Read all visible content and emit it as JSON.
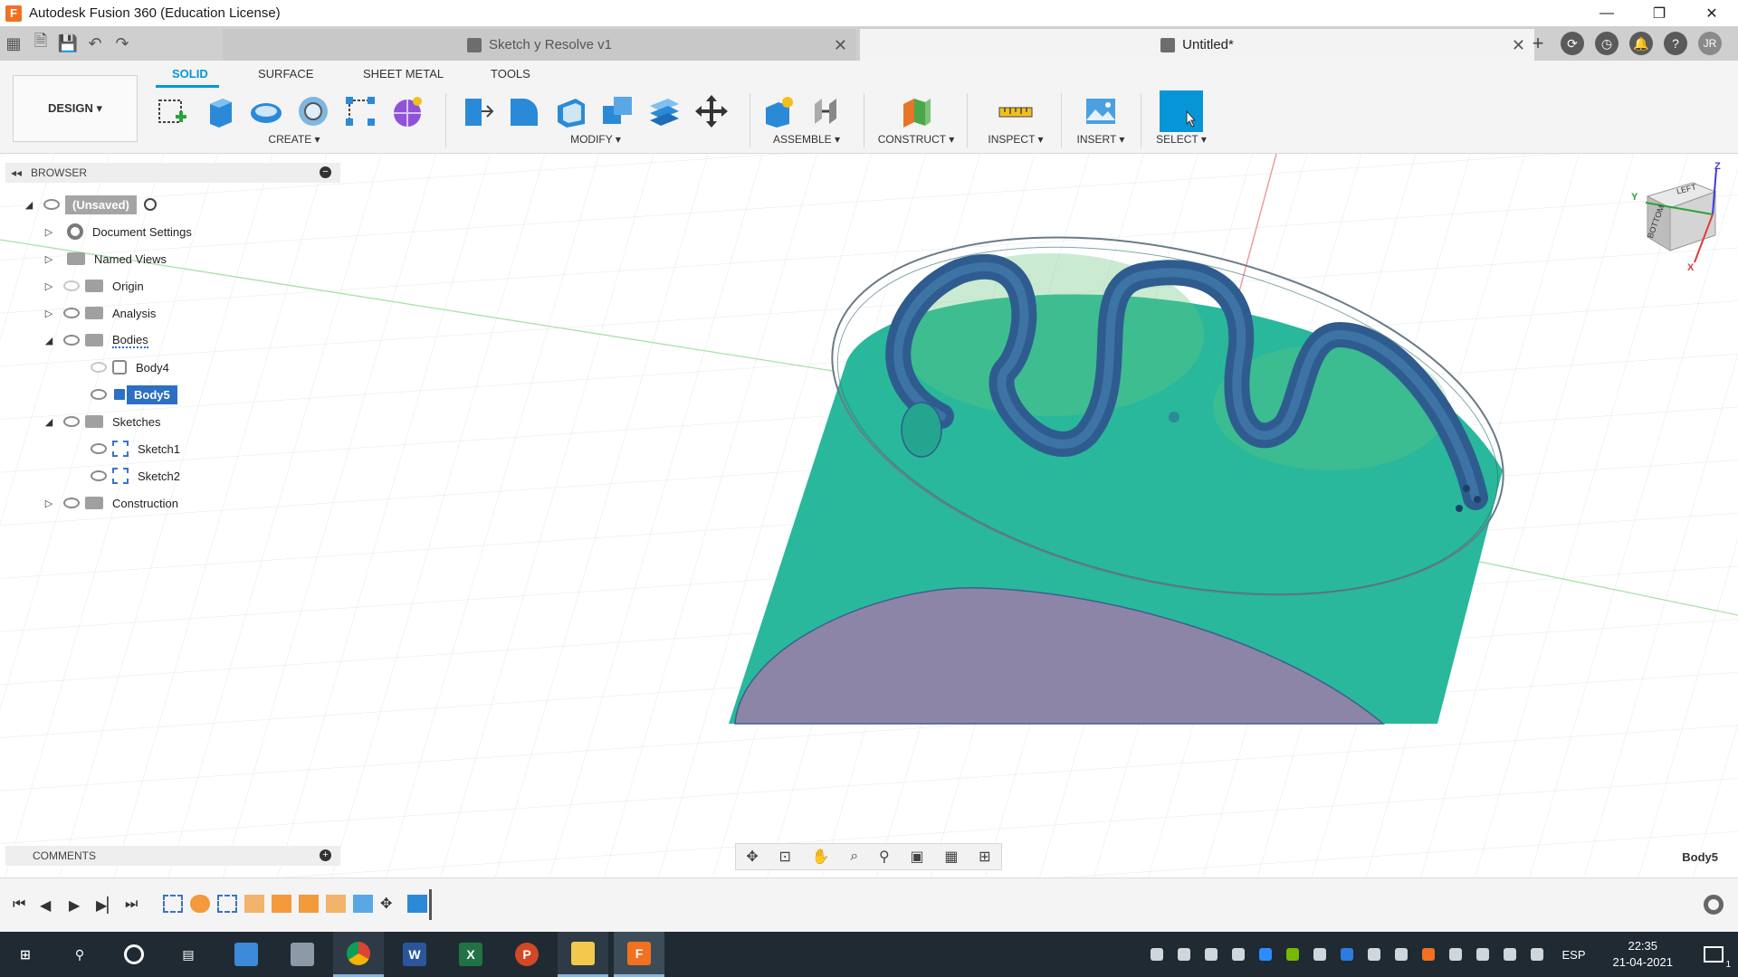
{
  "window": {
    "title": "Autodesk Fusion 360 (Education License)",
    "app_logo": "F"
  },
  "tabs": [
    {
      "label": "Sketch y Resolve v1",
      "active": false
    },
    {
      "label": "Untitled*",
      "active": true
    }
  ],
  "user": {
    "initials": "JR"
  },
  "toolbar": {
    "design_label": "DESIGN ▾",
    "workspace_tabs": [
      "SOLID",
      "SURFACE",
      "SHEET METAL",
      "TOOLS"
    ],
    "groups": {
      "create": "CREATE ▾",
      "modify": "MODIFY ▾",
      "assemble": "ASSEMBLE ▾",
      "construct": "CONSTRUCT ▾",
      "inspect": "INSPECT ▾",
      "insert": "INSERT ▾",
      "select": "SELECT ▾"
    }
  },
  "browser": {
    "title": "BROWSER",
    "root": "(Unsaved)",
    "items": {
      "document_settings": "Document Settings",
      "named_views": "Named Views",
      "origin": "Origin",
      "analysis": "Analysis",
      "bodies": "Bodies",
      "body4": "Body4",
      "body5": "Body5",
      "sketches": "Sketches",
      "sketch1": "Sketch1",
      "sketch2": "Sketch2",
      "construction": "Construction"
    }
  },
  "viewcube": {
    "faces": [
      "LEFT",
      "BOTTOM"
    ],
    "axes": [
      "X",
      "Y",
      "Z"
    ]
  },
  "comments": {
    "title": "COMMENTS"
  },
  "status": {
    "selected_body": "Body5"
  },
  "taskbar": {
    "language": "ESP",
    "time": "22:35",
    "date": "21-04-2021",
    "notifications": "1"
  },
  "colors": {
    "accent": "#0696d7",
    "body_green": "#1db394",
    "groove_blue": "#2f5c8f",
    "selection_blue": "#2c6fc4",
    "bottom_face": "#8c83a8"
  }
}
